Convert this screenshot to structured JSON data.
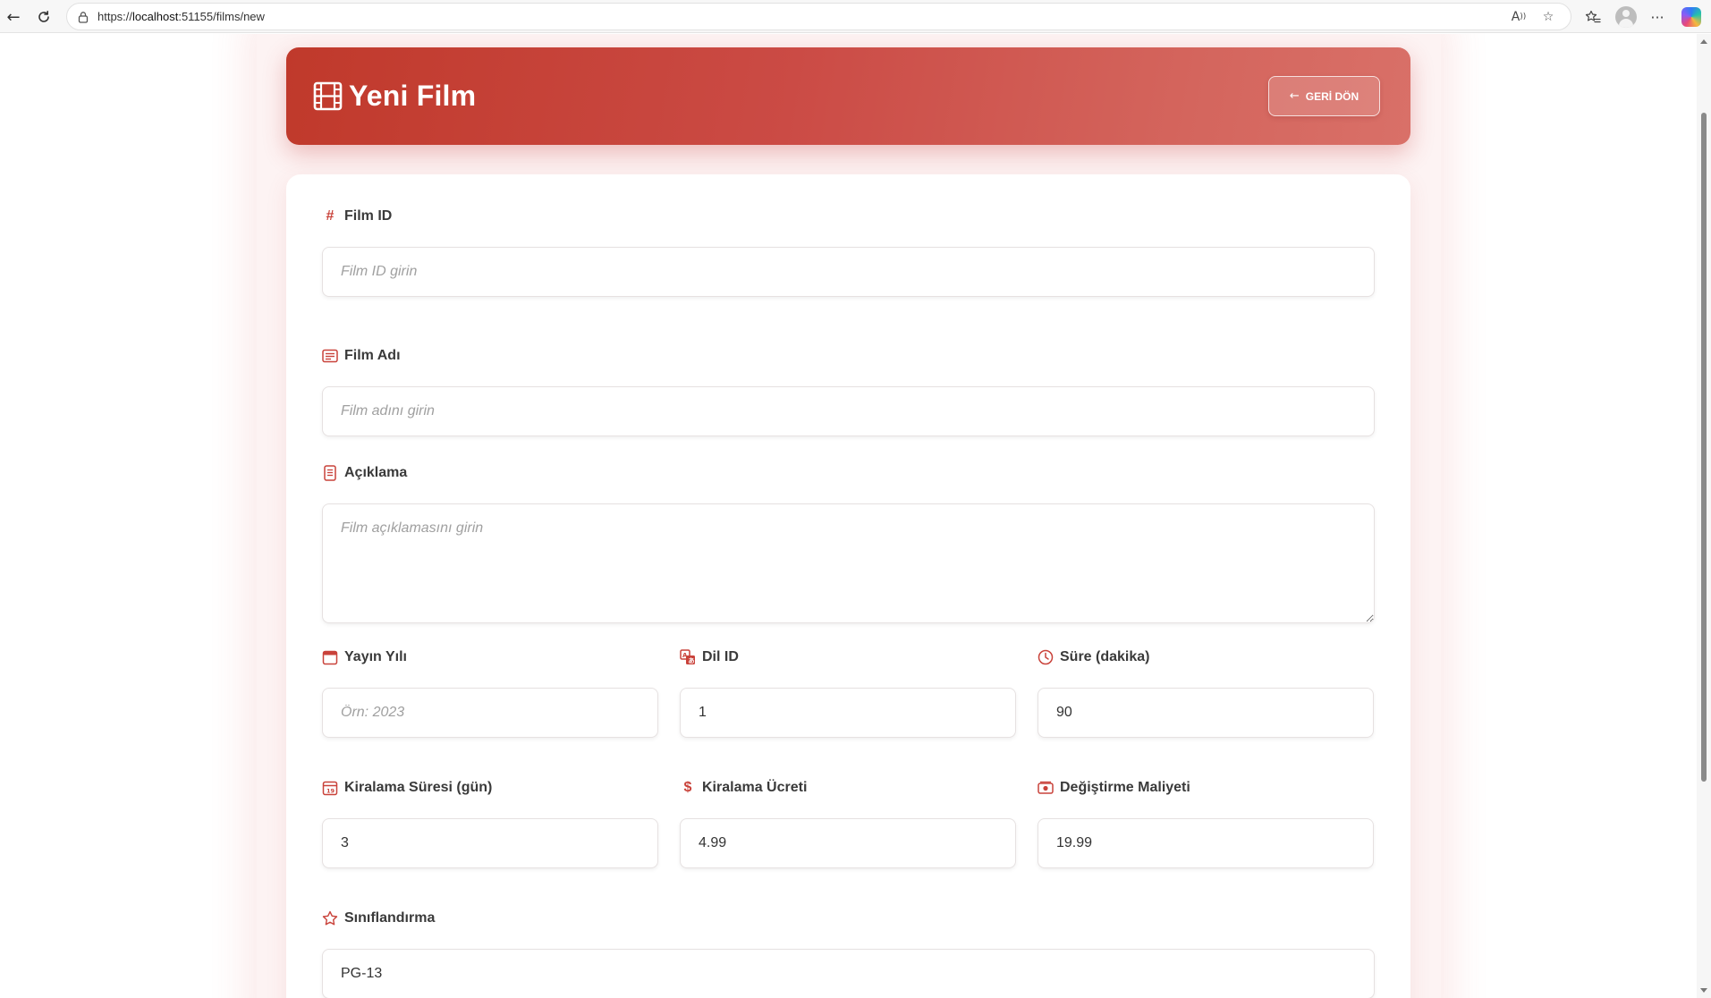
{
  "browser": {
    "url_prefix": "https://",
    "url_host": "localhost",
    "url_rest": ":51155/films/new"
  },
  "header": {
    "title": "Yeni Film",
    "back_label": "GERİ DÖN"
  },
  "colors": {
    "accent": "#c9423a",
    "header_gradient_start": "#c0392b",
    "header_gradient_end": "#d97068"
  },
  "form": {
    "film_id": {
      "label": "Film ID",
      "icon": "hash-icon",
      "value": "",
      "placeholder": "Film ID girin"
    },
    "film_name": {
      "label": "Film Adı",
      "icon": "text-lines-icon",
      "value": "",
      "placeholder": "Film adını girin"
    },
    "description": {
      "label": "Açıklama",
      "icon": "document-icon",
      "value": "",
      "placeholder": "Film açıklamasını girin"
    },
    "release_year": {
      "label": "Yayın Yılı",
      "icon": "calendar-icon",
      "value": "",
      "placeholder": "Örn: 2023"
    },
    "language_id": {
      "label": "Dil ID",
      "icon": "translate-icon",
      "value": "1",
      "placeholder": ""
    },
    "duration": {
      "label": "Süre (dakika)",
      "icon": "clock-icon",
      "value": "90",
      "placeholder": ""
    },
    "rental_duration": {
      "label": "Kiralama Süresi (gün)",
      "icon": "calendar-day-icon",
      "value": "3",
      "placeholder": ""
    },
    "rental_rate": {
      "label": "Kiralama Ücreti",
      "icon": "dollar-icon",
      "value": "4.99",
      "placeholder": ""
    },
    "replacement_cost": {
      "label": "Değiştirme Maliyeti",
      "icon": "cash-icon",
      "value": "19.99",
      "placeholder": ""
    },
    "rating": {
      "label": "Sınıflandırma",
      "icon": "star-icon",
      "value": "PG-13",
      "placeholder": ""
    }
  }
}
